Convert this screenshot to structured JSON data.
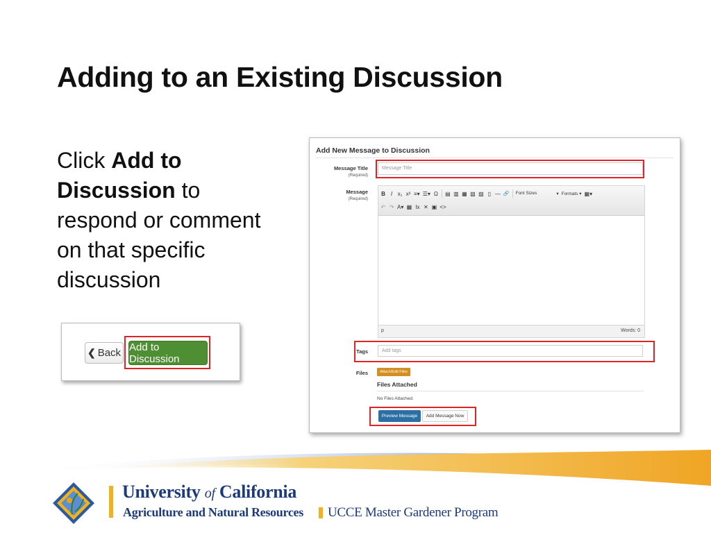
{
  "slide": {
    "title": "Adding to an Existing Discussion",
    "instruction": {
      "before": "Click ",
      "bold": "Add to Discussion",
      "after": " to respond or comment on that specific discussion"
    }
  },
  "small_screenshot": {
    "back_label": "Back",
    "add_to_discussion_label": "Add to Discussion"
  },
  "form": {
    "heading": "Add New Message to Discussion",
    "message_title_label": "Message Title",
    "required_label": "(Required)",
    "message_title_placeholder": "Message Title",
    "message_label": "Message",
    "toolbar_row1": [
      "B",
      "I",
      "x₁",
      "x²",
      "≡▾",
      "☰▾",
      "Ω",
      "▤",
      "▥",
      "▦",
      "▧",
      "▨",
      "▯",
      "—",
      "🔗"
    ],
    "font_sizes_label": "Font Sizes",
    "formats_label": "Formats",
    "toolbar_row2": [
      "↶",
      "↷",
      "A▾",
      "▦",
      "Ix",
      "✕",
      "▣",
      "<>"
    ],
    "editor_path": "p",
    "words_label": "Words: 0",
    "tags_label": "Tags",
    "tags_placeholder": "Add tags",
    "files_label": "Files",
    "attach_button": "Attach/Edit Files",
    "files_attached_heading": "Files Attached",
    "no_files_text": "No Files Attached.",
    "preview_button": "Preview Message",
    "add_now_button": "Add Message Now"
  },
  "footer": {
    "uc_name_before": "University",
    "uc_name_of": "of",
    "uc_name_after": "California",
    "uc_subtitle": "Agriculture and Natural Resources",
    "program_name": "UCCE Master Gardener Program"
  },
  "colors": {
    "highlight_red": "#e02424",
    "button_green": "#4e8f33",
    "uc_blue": "#1d3b7a",
    "uc_gold": "#f2b21b",
    "preview_blue": "#2b6fa5",
    "attach_orange": "#d38f21"
  }
}
